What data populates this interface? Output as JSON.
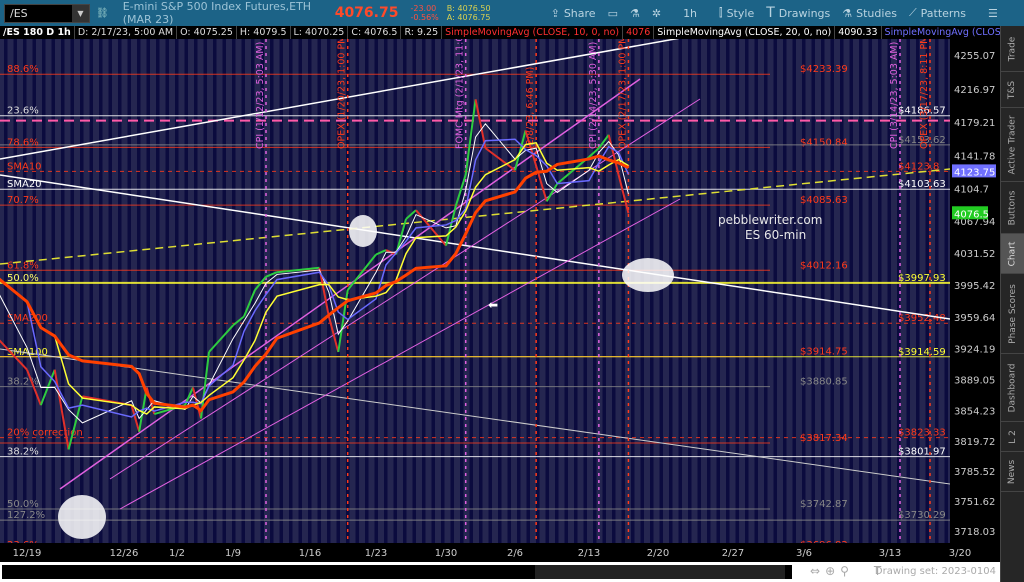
{
  "toolbar": {
    "symbol": "/ES",
    "description": "E-mini S&P 500 Index Futures,ETH (MAR 23)",
    "last": "4076.75",
    "change": "-23.00",
    "change_pct": "-0.56%",
    "bid": "B: 4076.50",
    "ask": "A: 4076.75",
    "share": "Share",
    "timeframe": "1h",
    "style": "Style",
    "drawings": "Drawings",
    "studies": "Studies",
    "patterns": "Patterns"
  },
  "infobar": {
    "symbol": "/ES 180 D 1h",
    "date": "D: 2/17/23, 5:00 AM",
    "open": "O: 4075.25",
    "high": "H: 4079.5",
    "low": "L: 4070.25",
    "close": "C: 4076.5",
    "range": "R: 9.25",
    "sma10": "SimpleMovingAvg (CLOSE, 10, 0, no)",
    "sma10_val": "4076",
    "sma20": "SimpleMovingAvg (CLOSE, 20, 0, no)",
    "sma20_val": "4090.33",
    "sma50": "SimpleMovingAvg (CLOSE,..."
  },
  "sidebar": [
    "Trade",
    "T&S",
    "Active Trader",
    "Buttons",
    "Chart",
    "Phase Scores",
    "Dashboard",
    "L 2",
    "News"
  ],
  "bottom": {
    "drawing_set": "Drawing set: 2023-0104"
  },
  "watermark": {
    "line1": "pebblewriter.com",
    "line2": "ES  60-min"
  },
  "colors": {
    "background": "#252650",
    "session_stripe": "#0b0b3e",
    "price_up": "#2ecc40",
    "price_down": "#e0302a",
    "sma10": "#ffffff",
    "sma20": "#6a6aff",
    "sma50": "#ffff33",
    "sma100": "#ff4000",
    "fib": "#ff3a1a",
    "event": "#e060e0",
    "last_price_tag": "#22cc22",
    "sma_tag": "#7070ff"
  },
  "chart_data": {
    "type": "line",
    "y_ticks": [
      "4255.07",
      "4216.97",
      "4179.21",
      "4141.78",
      "4104.7",
      "4067.94",
      "4031.52",
      "3995.42",
      "3959.64",
      "3924.19",
      "3889.05",
      "3854.23",
      "3819.72",
      "3785.52",
      "3751.62",
      "3718.03"
    ],
    "x_ticks": [
      "12/19",
      "12/26",
      "1/2",
      "1/9",
      "1/16",
      "1/23",
      "1/30",
      "2/6",
      "2/13",
      "2/20",
      "2/27",
      "3/6",
      "3/13",
      "3/20"
    ],
    "price_tags": {
      "sma20": "4123.75",
      "last": "4076.5"
    },
    "price": [
      [
        "12/15",
        4080
      ],
      [
        "12/16",
        3950
      ],
      [
        "12/19",
        3900
      ],
      [
        "12/20",
        3860
      ],
      [
        "12/21",
        3900
      ],
      [
        "12/22",
        3810
      ],
      [
        "12/23",
        3870
      ],
      [
        "12/27",
        3860
      ],
      [
        "12/28",
        3830
      ],
      [
        "12/29",
        3880
      ],
      [
        "12/30",
        3850
      ],
      [
        "1/3",
        3860
      ],
      [
        "1/4",
        3880
      ],
      [
        "1/5",
        3845
      ],
      [
        "1/6",
        3920
      ],
      [
        "1/9",
        3950
      ],
      [
        "1/10",
        3960
      ],
      [
        "1/11",
        3990
      ],
      [
        "1/12",
        4005
      ],
      [
        "1/13",
        4010
      ],
      [
        "1/17",
        4015
      ],
      [
        "1/18",
        3960
      ],
      [
        "1/19",
        3920
      ],
      [
        "1/20",
        3990
      ],
      [
        "1/23",
        4030
      ],
      [
        "1/24",
        4035
      ],
      [
        "1/25",
        4030
      ],
      [
        "1/26",
        4070
      ],
      [
        "1/27",
        4080
      ],
      [
        "1/30",
        4040
      ],
      [
        "1/31",
        4085
      ],
      [
        "2/1",
        4120
      ],
      [
        "2/2",
        4205
      ],
      [
        "2/3",
        4150
      ],
      [
        "2/6",
        4125
      ],
      [
        "2/7",
        4170
      ],
      [
        "2/8",
        4130
      ],
      [
        "2/9",
        4090
      ],
      [
        "2/10",
        4110
      ],
      [
        "2/13",
        4140
      ],
      [
        "2/14",
        4150
      ],
      [
        "2/15",
        4165
      ],
      [
        "2/16",
        4120
      ],
      [
        "2/17",
        4076.5
      ]
    ],
    "levels_left": [
      {
        "label": "88.6%",
        "price": 4233.39,
        "color": "#ff3a1a"
      },
      {
        "label": "23.6%",
        "price": 4186.57,
        "color": "#dddddd"
      },
      {
        "label": "78.6%",
        "price": 4150.84,
        "color": "#ff3a1a"
      },
      {
        "label": "SMA10",
        "price": 4123.8,
        "color": "#ff3a1a"
      },
      {
        "label": "SMA20",
        "price": 4103.63,
        "color": "#ffffff"
      },
      {
        "label": "70.7%",
        "price": 4085.63,
        "color": "#ff3a1a"
      },
      {
        "label": "61.8%",
        "price": 4012.16,
        "color": "#ff3a1a"
      },
      {
        "label": "50.0%",
        "price": 3997.93,
        "color": "#ffff66"
      },
      {
        "label": "SMA200",
        "price": 3952.48,
        "color": "#ff3a1a"
      },
      {
        "label": "SMA100",
        "price": 3914.59,
        "color": "#ffff33"
      },
      {
        "label": "38.2%",
        "price": 3880.85,
        "color": "#888888"
      },
      {
        "label": "20% correction",
        "price": 3823.33,
        "color": "#ff3a1a"
      },
      {
        "label": "38.2%",
        "price": 3801.97,
        "color": "#dddddd"
      },
      {
        "label": "50.0%",
        "price": 3742.87,
        "color": "#888888"
      },
      {
        "label": "127.2%",
        "price": 3730.29,
        "color": "#888888"
      },
      {
        "label": "23.6%",
        "price": 3696.82,
        "color": "#ff3a1a"
      }
    ],
    "levels_mid": [
      {
        "label": "$4233.39",
        "price": 4233.39,
        "color": "#ff3a1a"
      },
      {
        "label": "$4150.84",
        "price": 4150.84,
        "color": "#ff3a1a"
      },
      {
        "label": "$4085.63",
        "price": 4085.63,
        "color": "#ff3a1a"
      },
      {
        "label": "$4012.16",
        "price": 4012.16,
        "color": "#ff3a1a"
      },
      {
        "label": "$3914.75",
        "price": 3914.75,
        "color": "#ff3a1a"
      },
      {
        "label": "$3880.85",
        "price": 3880.85,
        "color": "#888888"
      },
      {
        "label": "$3817.34",
        "price": 3817.34,
        "color": "#ff3a1a"
      },
      {
        "label": "$3742.87",
        "price": 3742.87,
        "color": "#888888"
      },
      {
        "label": "$3696.82",
        "price": 3696.82,
        "color": "#ff3a1a"
      }
    ],
    "levels_right": [
      {
        "label": "$4186.57",
        "price": 4186.57,
        "color": "#ffffff"
      },
      {
        "label": "$4153.62",
        "price": 4153.62,
        "color": "#888888"
      },
      {
        "label": "$4123.8",
        "price": 4123.8,
        "color": "#ff3a1a"
      },
      {
        "label": "$4103.63",
        "price": 4103.63,
        "color": "#ffffff"
      },
      {
        "label": "$3997.93",
        "price": 3997.93,
        "color": "#ffff33"
      },
      {
        "label": "$3952.48",
        "price": 3952.48,
        "color": "#ff3a1a"
      },
      {
        "label": "$3914.59",
        "price": 3914.59,
        "color": "#ffff33"
      },
      {
        "label": "$3823.33",
        "price": 3823.33,
        "color": "#ff3a1a"
      },
      {
        "label": "$3801.97",
        "price": 3801.97,
        "color": "#ffffff"
      },
      {
        "label": "$3730.29",
        "price": 3730.29,
        "color": "#888888"
      }
    ],
    "events": [
      {
        "label": "OPEX (12/16/22, 1:00 PM)",
        "date": "12/16",
        "color": "#ff3a1a"
      },
      {
        "label": "CPI (1/12/23, 5:03 AM)",
        "date": "1/12",
        "color": "#e060e0"
      },
      {
        "label": "OPEX (1/20/23, 1:00 PM)",
        "date": "1/20",
        "color": "#ff3a1a"
      },
      {
        "label": "FOMC Mtg (2/1/23, 11:00 AM)",
        "date": "2/1",
        "color": "#e060e0"
      },
      {
        "label": "(2/8/23, 6:46 PM)",
        "date": "2/8",
        "color": "#ff3a1a"
      },
      {
        "label": "CPI (2/14/23, 5:30 AM)",
        "date": "2/14",
        "color": "#e060e0"
      },
      {
        "label": "OPEX (2/17/23, 1:00 PM)",
        "date": "2/17",
        "color": "#ff3a1a"
      },
      {
        "label": "CPI (3/14/23, 5:03 AM)",
        "date": "3/14",
        "color": "#e060e0"
      },
      {
        "label": "OPEX (3/17/23, 8:11 PM)",
        "date": "3/17",
        "color": "#ff3a1a"
      }
    ]
  }
}
